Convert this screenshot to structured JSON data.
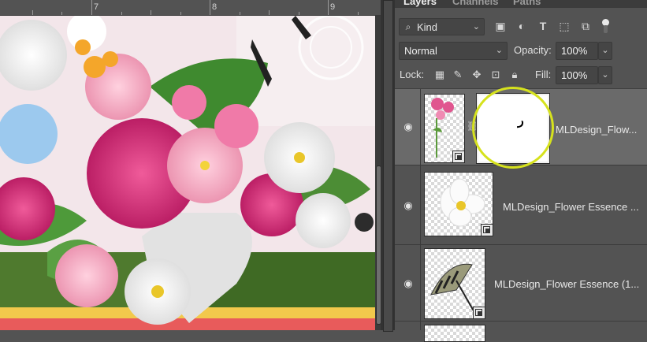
{
  "ruler": {
    "numbers": [
      "7",
      "8",
      "9"
    ]
  },
  "panel": {
    "tabs": [
      "Layers",
      "Channels",
      "Paths"
    ],
    "filter": {
      "kind_label": "Kind",
      "icons": [
        "search-icon",
        "pixel-layer-filter-icon",
        "adjustment-layer-filter-icon",
        "type-layer-filter-icon",
        "shape-layer-filter-icon",
        "smart-object-filter-icon",
        "filter-toggle"
      ]
    },
    "blend_mode": "Normal",
    "opacity_label": "Opacity:",
    "opacity_value": "100%",
    "lock_label": "Lock:",
    "lock_icons": [
      "lock-transparent-pixels-icon",
      "lock-image-pixels-icon",
      "lock-position-icon",
      "lock-artboard-icon",
      "lock-all-icon"
    ],
    "fill_label": "Fill:",
    "fill_value": "100%",
    "layers": [
      {
        "name": "MLDesign_Flow...",
        "selected": true,
        "has_mask": true
      },
      {
        "name": "MLDesign_Flower Essence ...",
        "selected": false,
        "has_mask": false
      },
      {
        "name": "MLDesign_Flower Essence (1...",
        "selected": false,
        "has_mask": false
      }
    ]
  },
  "colors": {
    "panel_bg": "#535353",
    "selected_layer": "#6a6a6a",
    "annotation_ring": "#d6e21d"
  }
}
